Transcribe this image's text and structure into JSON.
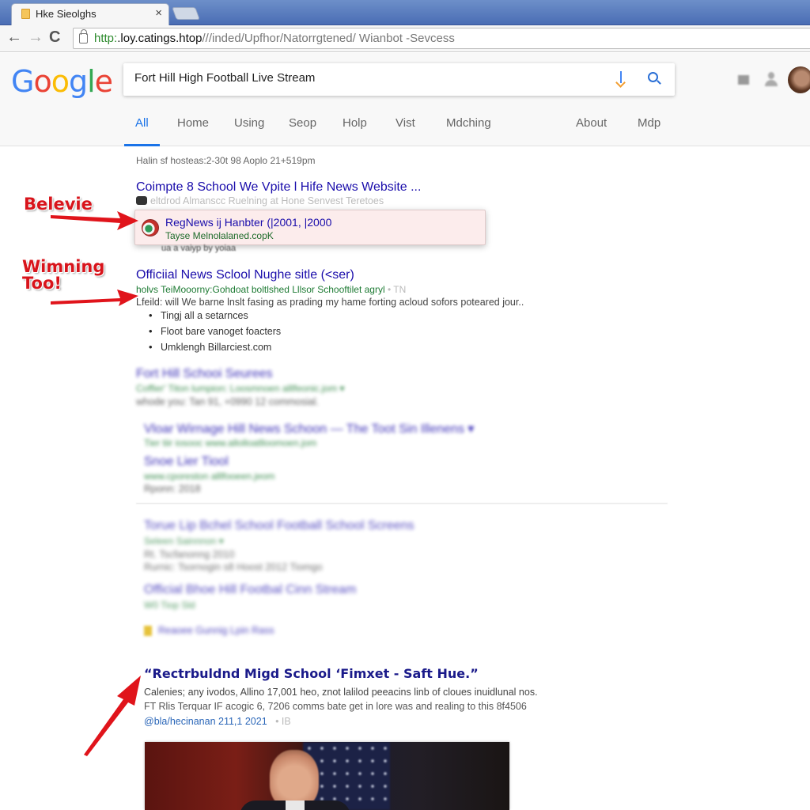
{
  "browser": {
    "tab_title": "Hke Sieolghs",
    "tab_close": "×",
    "url_scheme": "http:",
    "url_host": ".loy.catings.htop",
    "url_path": "///inded/Upfhor/Natorrgtened/ Wianbot -Sevcess",
    "back": "←",
    "forward": "→",
    "reload": "C"
  },
  "google": {
    "logo": [
      "G",
      "o",
      "o",
      "g",
      "l",
      "e"
    ],
    "search_value": "Fort Hill High Football Live Stream",
    "tabs": [
      {
        "label": "All",
        "active": true
      },
      {
        "label": "Home"
      },
      {
        "label": "Using"
      },
      {
        "label": "Seop"
      },
      {
        "label": "Holp"
      },
      {
        "label": "Vist"
      },
      {
        "label": "Mdching"
      },
      {
        "label": "About"
      },
      {
        "label": "Mdp"
      }
    ]
  },
  "results": {
    "stats": "Halin sf hosteas:2-30t 98 Aoplo 21+519pm",
    "items": [
      {
        "title": "Coimpte 8 School We Vpite l Hife News Website ...",
        "snippet": "eltdrod Almanscc Ruelning at Hone Senvest Teretoes"
      },
      {
        "title": "Officiial News  Sclool Nughe sitle (<ser)",
        "url": "holvs TeiMooorny:Gohdoat boltlshed Lllsor Schooftilet agryl",
        "url_extra": "• TN",
        "snippet": "Lfeild: will We barne lnslt fasing as prading my hame forting acloud sofors poteared jour..",
        "bullets": [
          "Tingj all a setarnces",
          "Floot bare vanoget foacters",
          "Umklengh Billarciest.com"
        ]
      },
      {
        "title": "Fort Hill Schooi Seurees",
        "url": "Coffier' Titon lumpion: Loosmnoen alllfeonic.jom  ▾",
        "snippet": "whode you:  Tan 91, +0990 12 commosial."
      },
      {
        "title": "Vloar Wirnage Hill News Schoon — The Toot Sin Illenens  ▾",
        "url": "Tier tiir iosooc www.allolloatlloomoen.jom"
      },
      {
        "title": "Snoe Lier Tiool",
        "url": "www.cporeston alllfooeen.jeom",
        "snippet": "Rponn: 2018"
      },
      {
        "title": "Torue Lip Bchel School Football School Screens",
        "url": "Seleen Sainnnon  ▾",
        "snippet": "Rt. Tscfanonng 2010",
        "snippet2": "Rurnic: Tsornogin s8 Hoost 2012 Tiomgo"
      },
      {
        "title": "Official Bhoe Hill Footbal  Cinn Stream",
        "url": "W0 Tiop Sld"
      },
      {
        "title": "Reaoee Gunnig Lpin Rass"
      },
      {
        "title": "“Rectrbuldnd Migd School  ‘Fimxet - Saft Hue.”",
        "snippet": "Calenies; any ivodos, Allino 17,001 heo, znot lalilod peeacins linb of cloues inuidlunal nos.",
        "snippet2": "FT Rlis Terquar IF acogic 6, 7206 comms bate get in lore was and realing to this 8f4506",
        "url": "@bla/hecinanan 211,1 2021",
        "url_extra": "• IB"
      }
    ],
    "callout": {
      "title": "RegNews ij Hanbter (|2001, |2000",
      "url": "Tayse Melnolalaned.copK",
      "below": "ua a vaiyp by yoiaa"
    }
  },
  "annotations": {
    "first": "Belevie",
    "second": "Wimning Too!"
  },
  "colors": {
    "link": "#1a0dab",
    "url_green": "#1e7b34",
    "annotation_red": "#d8141b",
    "accent_blue": "#1a73e8",
    "titlebar_blue": "#4a6db4"
  }
}
